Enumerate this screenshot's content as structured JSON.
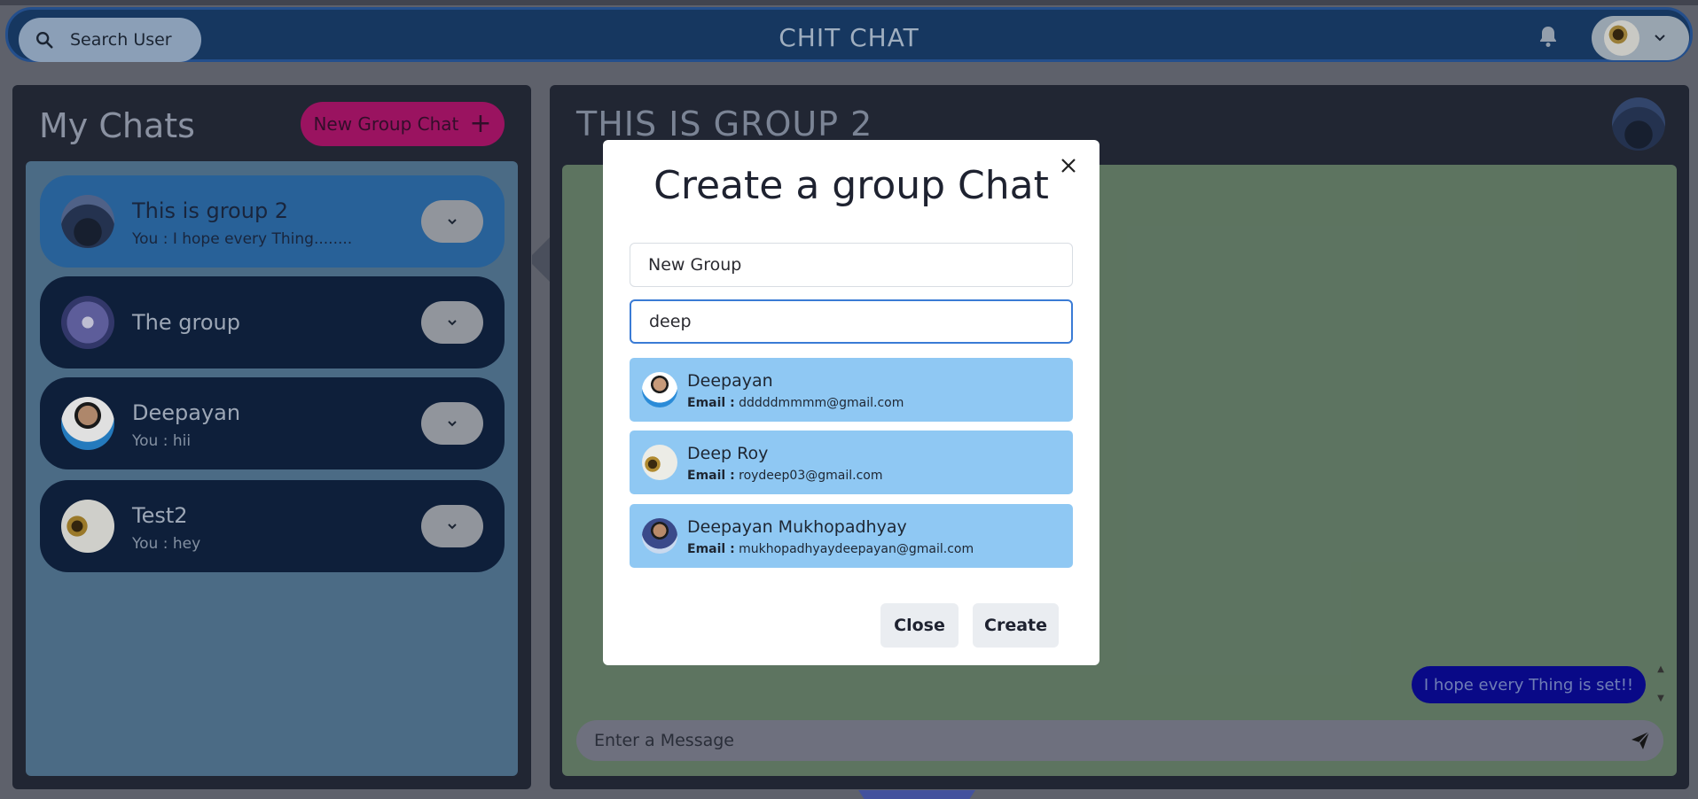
{
  "header": {
    "search_label": "Search User",
    "app_title": "CHIT CHAT"
  },
  "sidebar": {
    "title": "My Chats",
    "new_group_label": "New Group Chat",
    "new_group_icon": "+",
    "chats": [
      {
        "name": "This is group 2",
        "last_message": "You : I hope every Thing........",
        "active": true
      },
      {
        "name": "The group",
        "last_message": ""
      },
      {
        "name": "Deepayan",
        "last_message": "You : hii"
      },
      {
        "name": "Test2",
        "last_message": "You : hey"
      }
    ]
  },
  "chat": {
    "title": "THIS IS GROUP 2",
    "bubble_text": "I hope every Thing is set!!",
    "message_placeholder": "Enter a Message"
  },
  "modal": {
    "title": "Create a group Chat",
    "group_name_value": "New Group",
    "search_value": "deep",
    "email_label": "Email :",
    "results": [
      {
        "name": "Deepayan",
        "email": "dddddmmmm@gmail.com"
      },
      {
        "name": "Deep Roy",
        "email": "roydeep03@gmail.com"
      },
      {
        "name": "Deepayan Mukhopadhyay",
        "email": "mukhopadhyaydeepayan@gmail.com"
      }
    ],
    "close_label": "Close",
    "create_label": "Create"
  },
  "colors": {
    "header_bg": "#1a3f6e",
    "new_group_btn": "#b0166e",
    "active_chat": "#2e6fae",
    "inactive_chat": "#112443",
    "user_result_bg": "#8fc8f3",
    "bubble_bg": "#0b0b9a"
  }
}
